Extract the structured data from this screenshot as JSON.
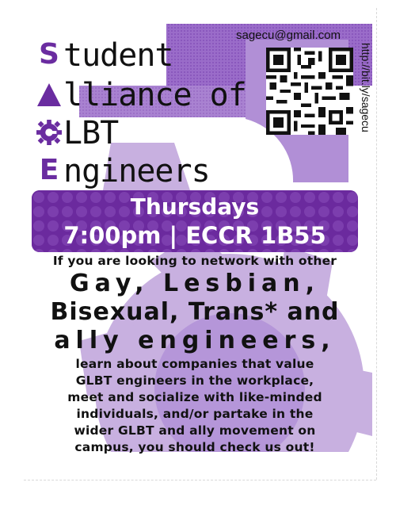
{
  "title": {
    "lines": [
      {
        "cap": "S",
        "rest": "tudent"
      },
      {
        "cap": "A",
        "rest": "lliance of"
      },
      {
        "cap": "G",
        "rest": "LBT"
      },
      {
        "cap": "E",
        "rest": "ngineers"
      }
    ],
    "cap_icons": [
      "s-letter",
      "triangle-icon",
      "gear-icon",
      "e-letter"
    ]
  },
  "contact": {
    "email": "sagecu@gmail.com",
    "url": "http://bit.ly/sagecu",
    "qr_icon": "qr-code-icon"
  },
  "banner": {
    "day": "Thursdays",
    "time_place": "7:00pm | ECCR 1B55"
  },
  "body": {
    "intro": "If you are looking to network with other",
    "big1": "Gay, Lesbian,",
    "big2": "Bisexual, Trans* and",
    "big3": "ally engineers,",
    "lines": [
      "learn about companies that value",
      "GLBT engineers in the workplace,",
      "meet and socialize with like-minded",
      "individuals, and/or partake in the",
      "wider GLBT and ally movement on",
      "campus, you should check us out!"
    ]
  },
  "colors": {
    "purple_dark": "#6b2a9e",
    "purple_mid": "#9a6cc9",
    "purple_light": "#c8b0e0"
  }
}
